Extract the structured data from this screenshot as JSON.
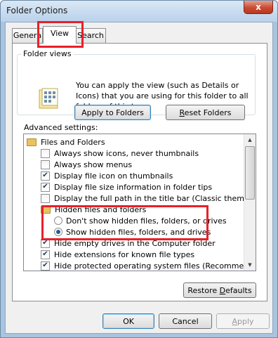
{
  "window": {
    "title": "Folder Options",
    "close_glyph": "x"
  },
  "tabs": [
    {
      "label": "General",
      "visible_label": "Genera"
    },
    {
      "label": "View"
    },
    {
      "label": "Search"
    }
  ],
  "folder_views": {
    "legend": "Folder views",
    "description": "You can apply the view (such as Details or Icons) that you are using for this folder to all folders of this type.",
    "apply_label": "Apply to Folders",
    "reset_label": "Reset Folders",
    "reset_mnemonic": "R",
    "reset_rest": "eset Folders"
  },
  "advanced": {
    "label": "Advanced settings:",
    "items": [
      {
        "type": "folder",
        "label": "Files and Folders"
      },
      {
        "type": "checkbox",
        "label": "Always show icons, never thumbnails",
        "checked": false
      },
      {
        "type": "checkbox",
        "label": "Always show menus",
        "checked": false
      },
      {
        "type": "checkbox",
        "label": "Display file icon on thumbnails",
        "checked": true
      },
      {
        "type": "checkbox",
        "label": "Display file size information in folder tips",
        "checked": true
      },
      {
        "type": "checkbox",
        "label": "Display the full path in the title bar (Classic theme only)",
        "checked": false
      },
      {
        "type": "folder",
        "label": "Hidden files and folders"
      },
      {
        "type": "radio",
        "label": "Don't show hidden files, folders, or drives",
        "selected": false
      },
      {
        "type": "radio",
        "label": "Show hidden files, folders, and drives",
        "selected": true
      },
      {
        "type": "checkbox",
        "label": "Hide empty drives in the Computer folder",
        "checked": true
      },
      {
        "type": "checkbox",
        "label": "Hide extensions for known file types",
        "checked": true
      },
      {
        "type": "checkbox",
        "label": "Hide protected operating system files (Recommended)",
        "checked": true
      }
    ],
    "restore_label": "Restore Defaults",
    "restore_pre": "Restore ",
    "restore_mnemonic": "D",
    "restore_rest": "efaults"
  },
  "footer": {
    "ok_label": "OK",
    "cancel_label": "Cancel",
    "apply_label": "Apply",
    "apply_mnemonic": "A",
    "apply_rest": "pply"
  },
  "colors": {
    "annotation": "#e8202a",
    "window_frame": "#a9c4df",
    "close_button": "#c94a32"
  }
}
